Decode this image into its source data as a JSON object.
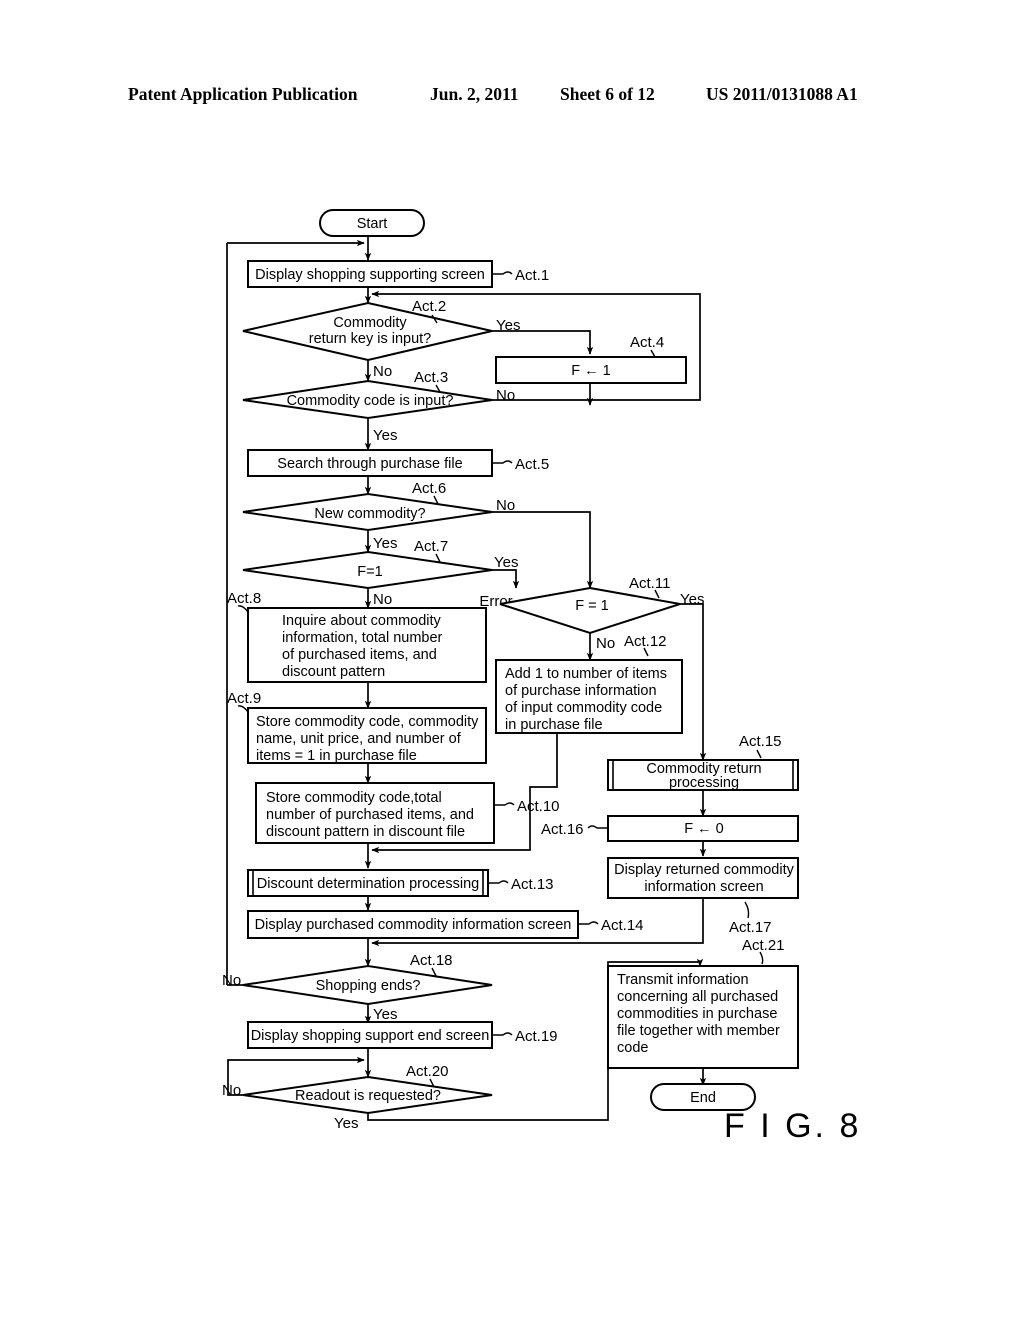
{
  "header": {
    "publication": "Patent Application Publication",
    "date": "Jun. 2, 2011",
    "sheet": "Sheet 6 of 12",
    "number": "US 2011/0131088 A1"
  },
  "figure": {
    "label": "F I G. 8"
  },
  "flowchart": {
    "terminators": {
      "start": "Start",
      "end": "End"
    },
    "nodes": {
      "act1": {
        "tag": "Act.1",
        "text": "Display shopping supporting screen"
      },
      "act2": {
        "tag": "Act.2",
        "line1": "Commodity",
        "line2": "return key is input?"
      },
      "act3": {
        "tag": "Act.3",
        "text": "Commodity code is input?"
      },
      "act4": {
        "tag": "Act.4",
        "text": "F ← 1"
      },
      "act5": {
        "tag": "Act.5",
        "text": "Search through purchase file"
      },
      "act6": {
        "tag": "Act.6",
        "text": "New commodity?"
      },
      "act7": {
        "tag": "Act.7",
        "text": "F=1"
      },
      "act8": {
        "tag": "Act.8",
        "line1": "Inquire about commodity",
        "line2": "information, total number",
        "line3": "of purchased items, and",
        "line4": "discount pattern"
      },
      "act9": {
        "tag": "Act.9",
        "line1": "Store commodity code, commodity",
        "line2": "name, unit price, and number of",
        "line3": "items = 1 in purchase file"
      },
      "act10": {
        "tag": "Act.10",
        "line1": "Store commodity code,total",
        "line2": "number of purchased items, and",
        "line3": "discount pattern in discount file"
      },
      "act11": {
        "tag": "Act.11",
        "text": "F = 1"
      },
      "act12": {
        "tag": "Act.12",
        "line1": "Add 1 to number of items",
        "line2": "of purchase information",
        "line3": "of input commodity code",
        "line4": "in purchase file"
      },
      "act13": {
        "tag": "Act.13",
        "text": "Discount determination processing"
      },
      "act14": {
        "tag": "Act.14",
        "text": "Display purchased commodity information screen"
      },
      "act15": {
        "tag": "Act.15",
        "line1": "Commodity return",
        "line2": "processing"
      },
      "act16": {
        "tag": "Act.16",
        "text": "F ← 0"
      },
      "act17": {
        "tag": "Act.17",
        "line1": "Display returned commodity",
        "line2": "information screen"
      },
      "act18": {
        "tag": "Act.18",
        "text": "Shopping ends?"
      },
      "act19": {
        "tag": "Act.19",
        "text": "Display shopping support end screen"
      },
      "act20": {
        "tag": "Act.20",
        "text": "Readout is requested?"
      },
      "act21": {
        "tag": "Act.21",
        "line1": "Transmit information",
        "line2": "concerning all purchased",
        "line3": "commodities in purchase",
        "line4": "file together with member",
        "line5": "code"
      }
    },
    "branch_labels": {
      "act2_yes": "Yes",
      "act2_no": "No",
      "act3_no": "No",
      "act3_yes": "Yes",
      "act6_no": "No",
      "act6_yes": "Yes",
      "act7_yes": "Yes",
      "act7_no": "No",
      "act7_error": "Error",
      "act11_yes": "Yes",
      "act11_no": "No",
      "act18_no": "No",
      "act18_yes": "Yes",
      "act20_no": "No",
      "act20_yes": "Yes"
    }
  }
}
